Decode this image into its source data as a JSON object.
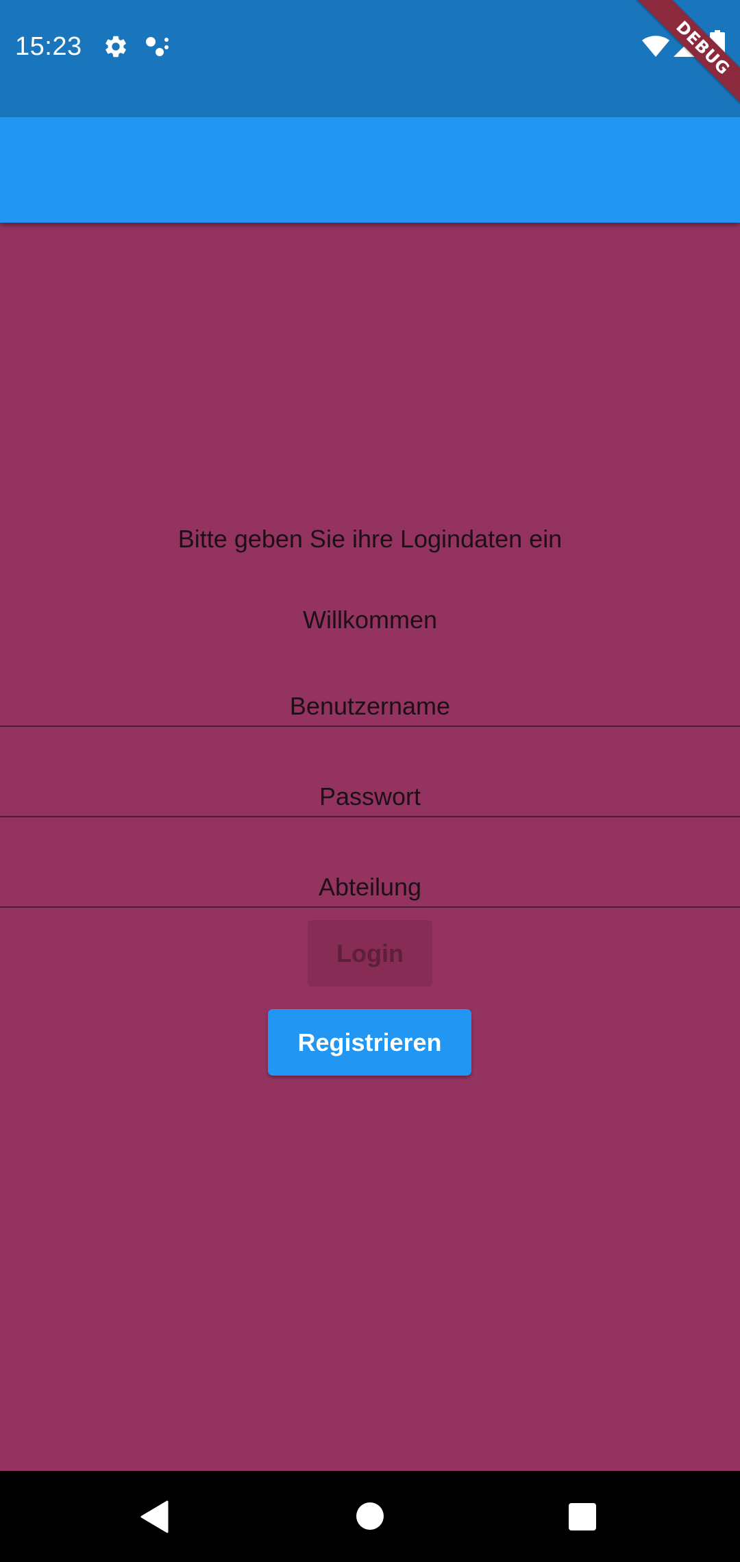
{
  "status_bar": {
    "time": "15:23",
    "icons": [
      "gear-icon",
      "dots-icon",
      "wifi-icon",
      "signal-icon",
      "battery-icon"
    ]
  },
  "debug_banner": {
    "label": "DEBUG"
  },
  "app_bar": {
    "title": ""
  },
  "main": {
    "prompt": "Bitte geben Sie ihre Logindaten ein",
    "welcome": "Willkommen",
    "fields": [
      {
        "label": "Benutzername",
        "value": ""
      },
      {
        "label": "Passwort",
        "value": ""
      },
      {
        "label": "Abteilung",
        "value": ""
      }
    ],
    "login_label": "Login",
    "register_label": "Registrieren"
  },
  "nav_bar": {
    "icons": [
      "back-icon",
      "home-icon",
      "recents-icon"
    ]
  },
  "colors": {
    "status_bar": "#1976BC",
    "app_bar": "#2196F3",
    "background": "#943360",
    "register_button": "#2196F3",
    "debug_banner": "#8B2A3C"
  }
}
